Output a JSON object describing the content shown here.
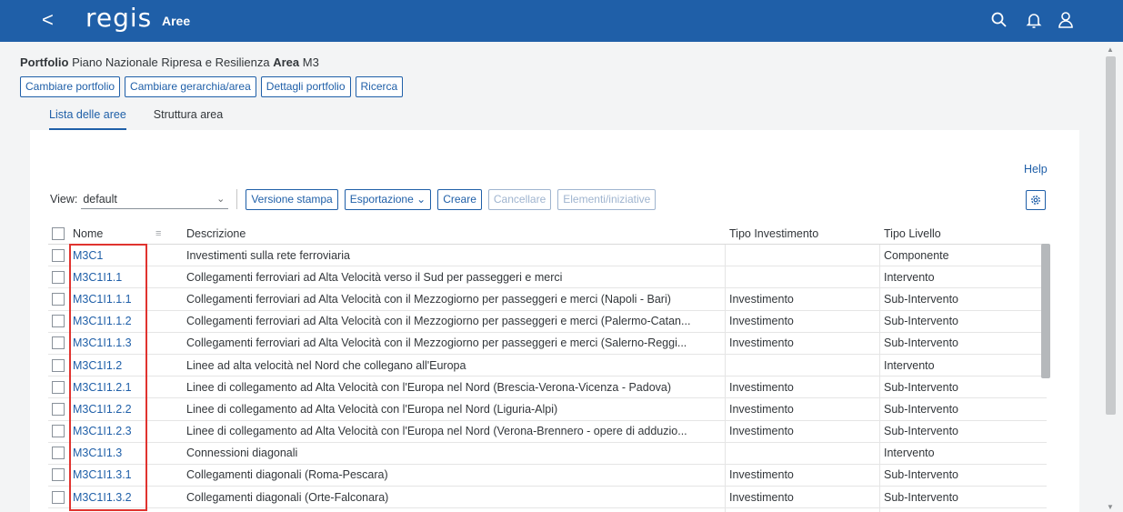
{
  "shell": {
    "back": "<",
    "logo": "regis",
    "title": "Aree",
    "icons": [
      "search-icon",
      "bell-icon",
      "user-icon"
    ]
  },
  "header": {
    "portfolio_label": "Portfolio",
    "portfolio_value": "Piano Nazionale Ripresa e Resilienza",
    "area_label": "Area",
    "area_value": "M3",
    "buttons": [
      "Cambiare portfolio",
      "Cambiare gerarchia/area",
      "Dettagli portfolio",
      "Ricerca"
    ],
    "tabs": [
      "Lista delle aree",
      "Struttura area"
    ]
  },
  "panel": {
    "help": "Help",
    "view_label": "View:",
    "view_value": "default",
    "toolbar": {
      "print": "Versione stampa",
      "export": "Esportazione",
      "create": "Creare",
      "delete": "Cancellare",
      "elements": "Elementi/iniziative"
    }
  },
  "table": {
    "columns": [
      "Nome",
      "Descrizione",
      "Tipo Investimento",
      "Tipo Livello"
    ],
    "rows": [
      {
        "name": "M3C1",
        "desc": "Investimenti sulla rete ferroviaria",
        "tipo": "",
        "livello": "Componente"
      },
      {
        "name": "M3C1I1.1",
        "desc": "Collegamenti ferroviari ad Alta Velocità verso il Sud per passeggeri e merci",
        "tipo": "",
        "livello": "Intervento"
      },
      {
        "name": "M3C1I1.1.1",
        "desc": "Collegamenti ferroviari ad Alta Velocità con il Mezzogiorno per passeggeri e merci (Napoli - Bari)",
        "tipo": "Investimento",
        "livello": "Sub-Intervento"
      },
      {
        "name": "M3C1I1.1.2",
        "desc": "Collegamenti ferroviari ad Alta Velocità con il Mezzogiorno per passeggeri e merci (Palermo-Catan...",
        "tipo": "Investimento",
        "livello": "Sub-Intervento"
      },
      {
        "name": "M3C1I1.1.3",
        "desc": "Collegamenti ferroviari ad Alta Velocità con il Mezzogiorno per passeggeri e merci (Salerno-Reggi...",
        "tipo": "Investimento",
        "livello": "Sub-Intervento"
      },
      {
        "name": "M3C1I1.2",
        "desc": "Linee ad alta velocità nel Nord che collegano all'Europa",
        "tipo": "",
        "livello": "Intervento"
      },
      {
        "name": "M3C1I1.2.1",
        "desc": "Linee di collegamento ad Alta Velocità con l'Europa nel Nord (Brescia-Verona-Vicenza - Padova)",
        "tipo": "Investimento",
        "livello": "Sub-Intervento"
      },
      {
        "name": "M3C1I1.2.2",
        "desc": "Linee di collegamento ad Alta Velocità con l'Europa nel Nord (Liguria-Alpi)",
        "tipo": "Investimento",
        "livello": "Sub-Intervento"
      },
      {
        "name": "M3C1I1.2.3",
        "desc": "Linee di collegamento ad Alta Velocità con l'Europa nel Nord (Verona-Brennero - opere di adduzio...",
        "tipo": "Investimento",
        "livello": "Sub-Intervento"
      },
      {
        "name": "M3C1I1.3",
        "desc": " Connessioni diagonali",
        "tipo": "",
        "livello": "Intervento"
      },
      {
        "name": "M3C1I1.3.1",
        "desc": "Collegamenti diagonali (Roma-Pescara)",
        "tipo": "Investimento",
        "livello": "Sub-Intervento"
      },
      {
        "name": "M3C1I1.3.2",
        "desc": "Collegamenti diagonali (Orte-Falconara)",
        "tipo": "Investimento",
        "livello": "Sub-Intervento"
      }
    ]
  },
  "colors": {
    "shell": "#1f5fa8",
    "link": "#1f5fa8",
    "highlight": "#e0332f"
  }
}
